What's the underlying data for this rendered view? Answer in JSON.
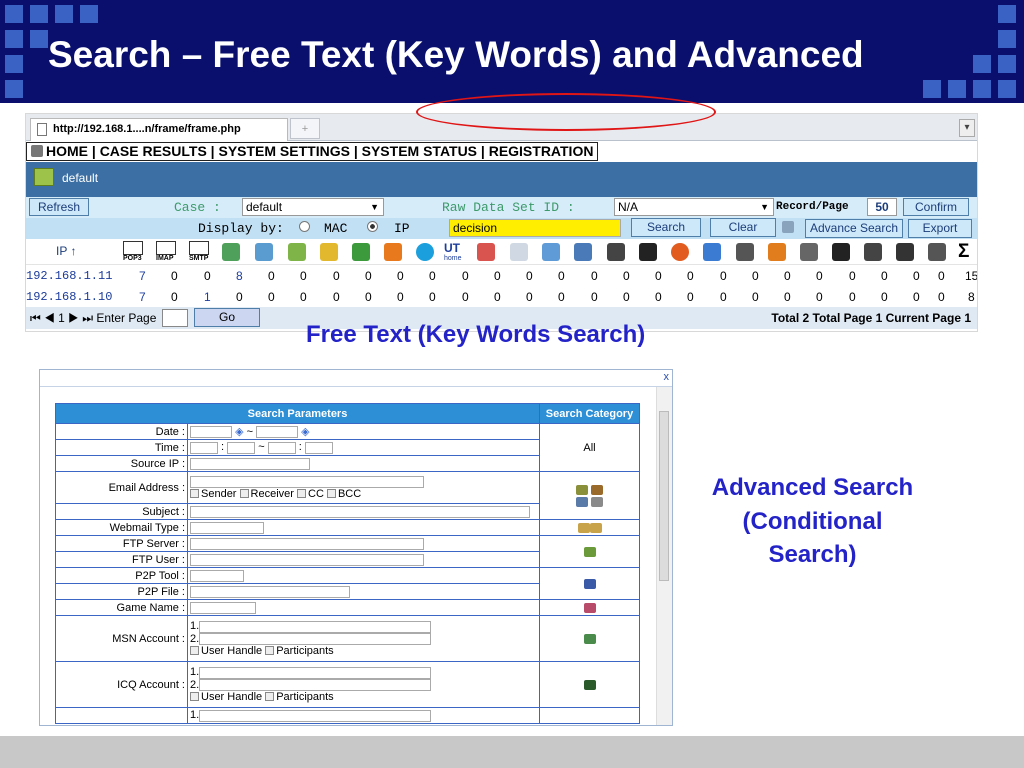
{
  "slide": {
    "title": "Search – Free Text (Key Words) and Advanced"
  },
  "browser": {
    "tab_title": "http://192.168.1....n/frame/frame.php",
    "new_tab": "+"
  },
  "menu": {
    "text": "HOME | CASE RESULTS | SYSTEM SETTINGS | SYSTEM STATUS | REGISTRATION"
  },
  "case_bar": {
    "name": "default"
  },
  "controls": {
    "refresh": "Refresh",
    "case_label": "Case :",
    "case_value": "default",
    "raw_label": "Raw Data Set ID :",
    "raw_value": "N/A",
    "record_label": "Record/Page",
    "record_value": "50",
    "confirm": "Confirm",
    "display_label": "Display by:",
    "mac_label": "MAC",
    "ip_label": "IP",
    "search_value": "decision",
    "search": "Search",
    "clear": "Clear",
    "advance_search": "Advance Search",
    "export": "Export"
  },
  "icon_header": {
    "ip": "IP ↑",
    "pop3": "POP3",
    "imap": "IMAP",
    "smtp": "SMTP",
    "ut": "UT",
    "ut_sub": "home"
  },
  "table": {
    "rows": [
      {
        "ip": "192.168.1.11",
        "v": [
          "7",
          "0",
          "0",
          "8",
          "0",
          "0",
          "0",
          "0",
          "0",
          "0",
          "0",
          "0",
          "0",
          "0",
          "0",
          "0",
          "0",
          "0",
          "0",
          "0",
          "0",
          "0",
          "0",
          "0",
          "0",
          "0",
          "0",
          "15"
        ]
      },
      {
        "ip": "192.168.1.10",
        "v": [
          "7",
          "0",
          "1",
          "0",
          "0",
          "0",
          "0",
          "0",
          "0",
          "0",
          "0",
          "0",
          "0",
          "0",
          "0",
          "0",
          "0",
          "0",
          "0",
          "0",
          "0",
          "0",
          "0",
          "0",
          "0",
          "0",
          "0",
          "8"
        ]
      }
    ]
  },
  "pager": {
    "nav": "⏮ ◀ 1 ▶ ⏭ Enter Page",
    "go": "Go",
    "status": "Total 2  Total Page 1  Current Page 1"
  },
  "captions": {
    "free": "Free Text  (Key Words Search)",
    "adv1": "Advanced Search",
    "adv2": "(Conditional",
    "adv3": "Search)"
  },
  "adv": {
    "close": "x",
    "h_params": "Search Parameters",
    "h_cat": "Search Category",
    "date": "Date :",
    "tilde": "~",
    "time": "Time :",
    "source_ip": "Source IP :",
    "email": "Email Address :",
    "sender": "Sender",
    "receiver": "Receiver",
    "cc": "CC",
    "bcc": "BCC",
    "subject": "Subject :",
    "webmail": "Webmail Type :",
    "ftp_server": "FTP Server :",
    "ftp_user": "FTP User :",
    "p2p_tool": "P2P Tool :",
    "p2p_file": "P2P File :",
    "game": "Game Name :",
    "msn": "MSN Account :",
    "icq": "ICQ Account :",
    "n1": "1.",
    "n2": "2.",
    "user_handle": "User Handle",
    "participants": "Participants",
    "all": "All"
  }
}
